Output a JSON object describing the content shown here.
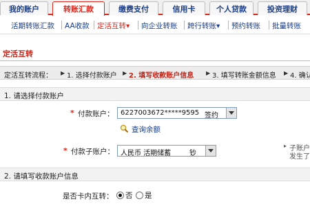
{
  "tabs": [
    {
      "label": "我的账户",
      "active": false
    },
    {
      "label": "转账汇款",
      "active": true
    },
    {
      "label": "缴费支付",
      "active": false
    },
    {
      "label": "信用卡",
      "active": false
    },
    {
      "label": "个人贷款",
      "active": false
    },
    {
      "label": "投资理财",
      "active": false
    }
  ],
  "subnav": [
    {
      "label": "活期转账汇款"
    },
    {
      "label": "AA收款"
    },
    {
      "label": "定活互转▾"
    },
    {
      "label": "向企业转账"
    },
    {
      "label": "跨行转账▾"
    },
    {
      "label": "预约转账"
    },
    {
      "label": "批量转账"
    }
  ],
  "page_title": "定活互转",
  "steps": {
    "prefix": "定活互转流程：",
    "items": [
      "1. 选择付款账户",
      "2. 填写收款账户信息",
      "3. 填写转账金额信息",
      "4. 确认"
    ]
  },
  "section1": "1. 请选择付款账户",
  "pay_account": {
    "label": "付款账户：",
    "value": "6227003672*****9595",
    "tag": "签约"
  },
  "query_balance": "查询余额",
  "sub_account": {
    "label": "付款子账户：",
    "value": "人民币 活期储蓄",
    "tag": "钞"
  },
  "hint_lines": [
    "子账户",
    "发生了"
  ],
  "section2": "2. 请填写收款账户信息",
  "same_card": {
    "label": "是否卡内互转：",
    "options": [
      "否",
      "是"
    ],
    "selected": "否"
  },
  "colors": {
    "accent": "#d8261a",
    "link": "#1a3c86"
  }
}
